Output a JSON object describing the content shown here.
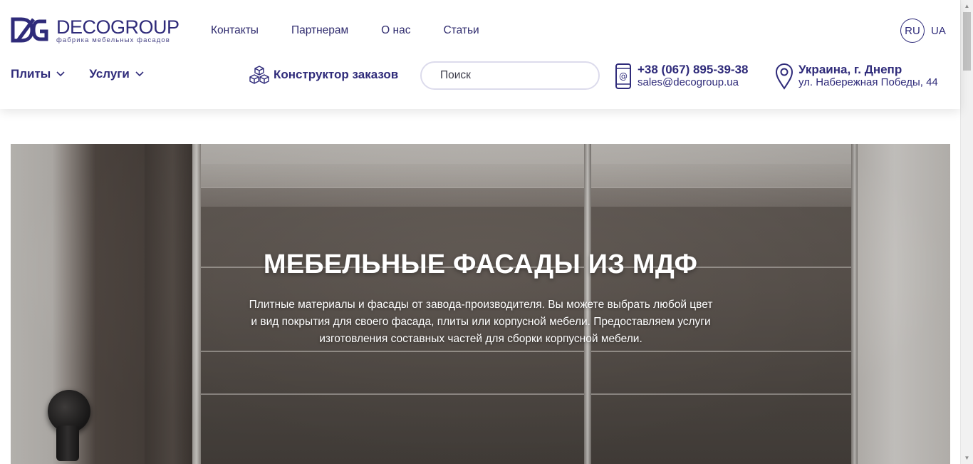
{
  "brand": {
    "name": "DECOGROUP",
    "tagline": "фабрика мебельных фасадов",
    "color": "#2f2b7a"
  },
  "topnav": {
    "items": [
      {
        "label": "Контакты"
      },
      {
        "label": "Партнерам"
      },
      {
        "label": "О нас"
      },
      {
        "label": "Статьи"
      }
    ]
  },
  "lang": {
    "active": "RU",
    "other": "UA"
  },
  "mainnav": {
    "items": [
      {
        "label": "Плиты",
        "icon": "chevron-down-icon"
      },
      {
        "label": "Услуги",
        "icon": "chevron-down-icon"
      }
    ]
  },
  "constructor": {
    "label": "Конструктор заказов",
    "icon": "cubes-icon"
  },
  "search": {
    "placeholder": "Поиск",
    "value": ""
  },
  "contact": {
    "phone": "+38 (067) 895-39-38",
    "email": "sales@decogroup.ua",
    "icon": "phone-email-icon"
  },
  "address": {
    "city": "Украина, г. Днепр",
    "street": "ул. Набережная Победы, 44",
    "icon": "location-pin-icon"
  },
  "hero": {
    "title": "МЕБЕЛЬНЫЕ ФАСАДЫ ИЗ МДФ",
    "subtitle": "Плитные материалы и фасады от завода-производителя. Вы можете выбрать любой цвет и вид покрытия для своего фасада, плиты или корпусной мебели. Предоставляем услуги изготовления составных частей для сборки корпусной мебели."
  }
}
